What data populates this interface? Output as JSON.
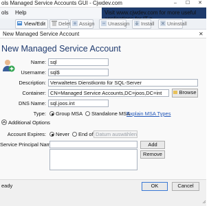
{
  "window": {
    "title": "ols  Managed Service Accounts GUI - Cjwdev.com"
  },
  "menu": {
    "items": [
      "ols",
      "Help"
    ],
    "visit_prefix": "Visit ",
    "visit_link": "www.cjwdev.com",
    "visit_suffix": " for more useful applications for IT p"
  },
  "toolbar": {
    "buttons": [
      "View/Edit",
      "Delete",
      "Assign",
      "Unassign",
      "Install",
      "Uninstall"
    ]
  },
  "dialog": {
    "title": "New Managed Service Account",
    "close": "✕",
    "heading": "New Managed Service Account",
    "form": {
      "name_label": "Name:",
      "name_value": "sql",
      "username_label": "Username:",
      "username_value": "sql$",
      "description_label": "Description:",
      "description_value": "Verwaltetes Dienstkonto für SQL-Server",
      "container_label": "Container:",
      "container_value": "CN=Managed Service Accounts,DC=joos,DC=int",
      "browse_label": "Browse",
      "dns_label": "DNS Name:",
      "dns_value": "sql.joos.int",
      "type_label": "Type:",
      "type_group": "Group MSA",
      "type_standalone": "Standalone MSA",
      "explain_link": "Explain MSA Types"
    },
    "additional_options_label": "Additional Options",
    "expires": {
      "label": "Account Expires:",
      "never": "Never",
      "endof": "End of:",
      "date_placeholder": "Datum auswählen"
    },
    "spn": {
      "label": "Service Principal Names:",
      "add": "Add",
      "remove": "Remove"
    },
    "status": "eady",
    "ok": "OK",
    "cancel": "Cancel"
  },
  "colors": {
    "accent": "#1f3a6e",
    "link": "#1f55b8",
    "visit_bar": "#1d3a6b"
  }
}
